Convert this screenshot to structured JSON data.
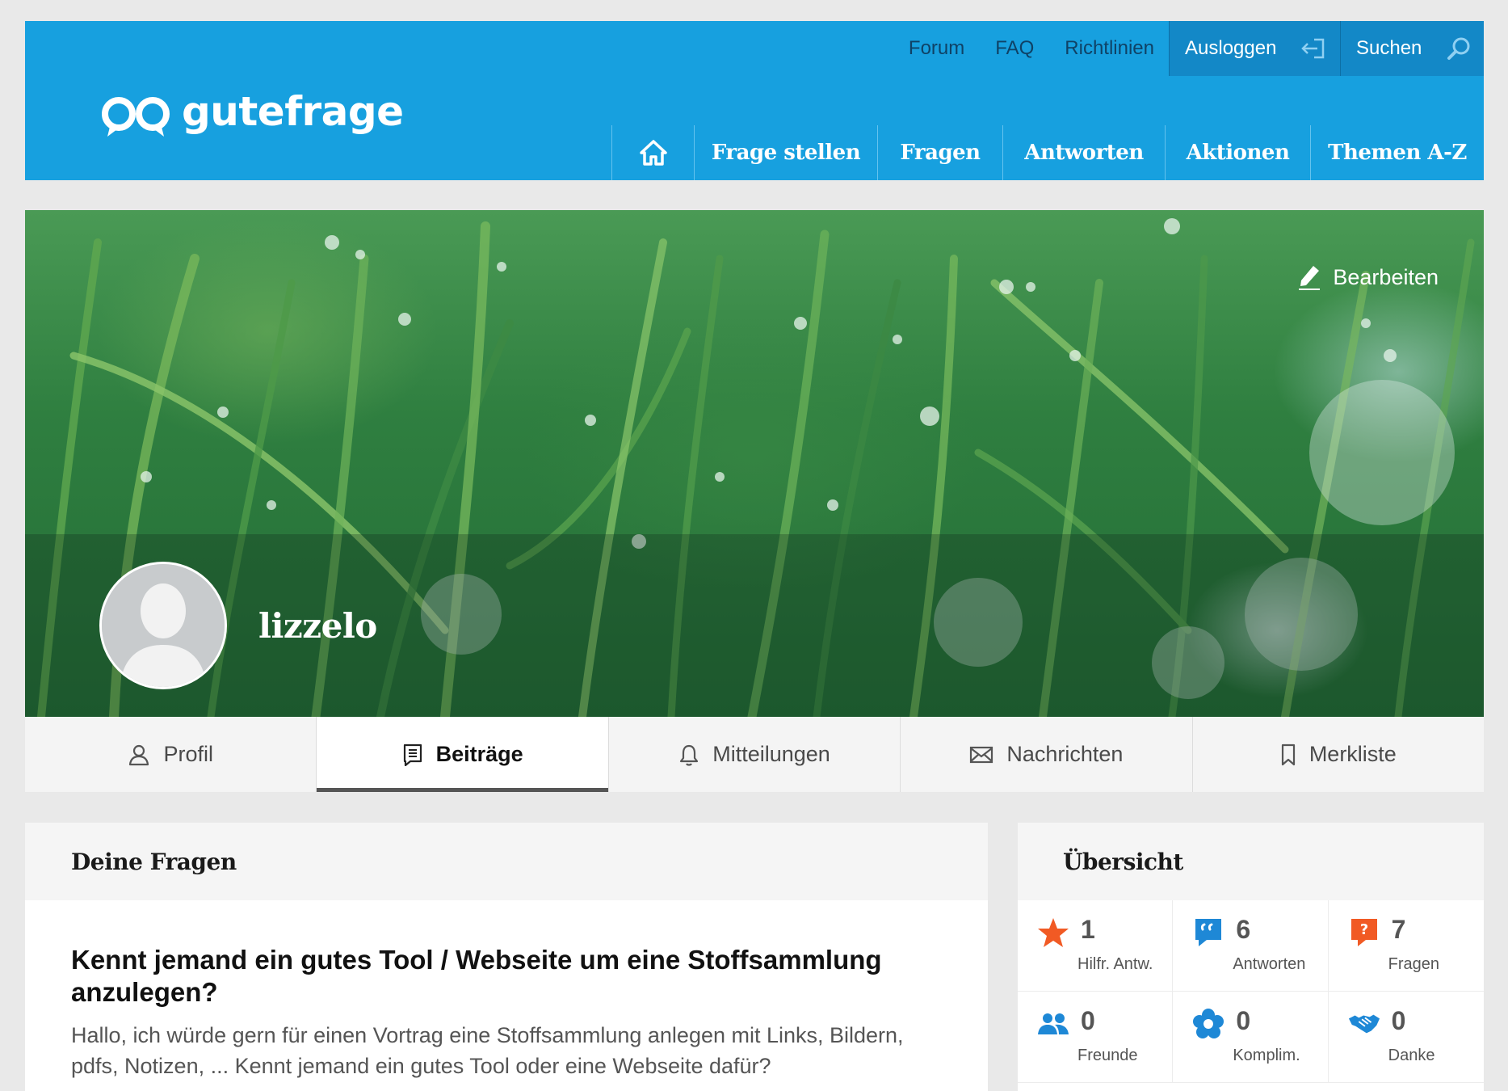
{
  "header": {
    "logo_text": "gutefrage",
    "top_links": [
      "Forum",
      "FAQ",
      "Richtlinien"
    ],
    "logout_label": "Ausloggen",
    "search_label": "Suchen",
    "main_nav": [
      "Frage stellen",
      "Fragen",
      "Antworten",
      "Aktionen",
      "Themen A-Z"
    ],
    "brand_color": "#17a0df"
  },
  "profile": {
    "edit_label": "Bearbeiten",
    "username": "lizzelo"
  },
  "tabs": [
    {
      "label": "Profil",
      "icon": "user-icon",
      "active": false
    },
    {
      "label": "Beiträge",
      "icon": "posts-icon",
      "active": true
    },
    {
      "label": "Mitteilungen",
      "icon": "bell-icon",
      "active": false
    },
    {
      "label": "Nachrichten",
      "icon": "envelope-icon",
      "active": false
    },
    {
      "label": "Merkliste",
      "icon": "bookmark-icon",
      "active": false
    }
  ],
  "questions": {
    "heading": "Deine Fragen",
    "items": [
      {
        "title": "Kennt jemand ein gutes Tool / Webseite um eine Stoffsammlung anzulegen?",
        "excerpt": "Hallo, ich würde gern für einen Vortrag eine Stoffsammlung anlegen mit Links, Bildern, pdfs, Notizen, ... Kennt jemand ein gutes Tool oder eine Webseite dafür?"
      }
    ]
  },
  "overview": {
    "heading": "Übersicht",
    "stats": [
      {
        "value": "1",
        "label": "Hilfr. Antw.",
        "icon": "star-icon",
        "color": "#f15a24"
      },
      {
        "value": "6",
        "label": "Antworten",
        "icon": "quote-bubble-icon",
        "color": "#1e88d6"
      },
      {
        "value": "7",
        "label": "Fragen",
        "icon": "question-bubble-icon",
        "color": "#f15a24"
      },
      {
        "value": "0",
        "label": "Freunde",
        "icon": "friends-icon",
        "color": "#1e88d6"
      },
      {
        "value": "0",
        "label": "Komplim.",
        "icon": "flower-icon",
        "color": "#1e88d6"
      },
      {
        "value": "0",
        "label": "Danke",
        "icon": "handshake-icon",
        "color": "#1e88d6"
      }
    ]
  }
}
